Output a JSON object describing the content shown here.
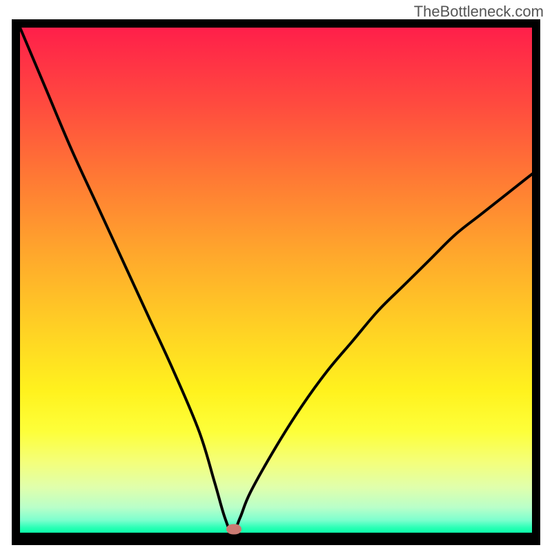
{
  "watermark": "TheBottleneck.com",
  "chart_data": {
    "type": "line",
    "title": "",
    "xlabel": "",
    "ylabel": "",
    "xlim": [
      0,
      100
    ],
    "ylim": [
      0,
      100
    ],
    "grid": false,
    "legend": false,
    "series": [
      {
        "name": "curve",
        "x": [
          0,
          5,
          10,
          15,
          20,
          25,
          30,
          35,
          38,
          40,
          41.5,
          43,
          45,
          50,
          55,
          60,
          65,
          70,
          75,
          80,
          85,
          90,
          95,
          100
        ],
        "y": [
          100,
          88,
          76,
          65,
          54,
          43,
          32,
          20,
          10,
          3,
          0,
          3,
          8,
          17,
          25,
          32,
          38,
          44,
          49,
          54,
          59,
          63,
          67,
          71
        ]
      }
    ],
    "marker": {
      "x": 41.8,
      "y": 0.7,
      "color": "#cb7a72"
    },
    "gradient_stops": [
      {
        "pct": 0,
        "color": "#ff1f4a"
      },
      {
        "pct": 15,
        "color": "#ff4a3f"
      },
      {
        "pct": 30,
        "color": "#ff7a34"
      },
      {
        "pct": 45,
        "color": "#ffa82c"
      },
      {
        "pct": 60,
        "color": "#ffd224"
      },
      {
        "pct": 72,
        "color": "#fff21e"
      },
      {
        "pct": 80,
        "color": "#fdff3a"
      },
      {
        "pct": 86,
        "color": "#f4ff7a"
      },
      {
        "pct": 91,
        "color": "#e0ffac"
      },
      {
        "pct": 95,
        "color": "#b9ffc9"
      },
      {
        "pct": 97.5,
        "color": "#7dffce"
      },
      {
        "pct": 99,
        "color": "#2affb6"
      },
      {
        "pct": 100,
        "color": "#0cffa8"
      }
    ],
    "frame_color": "#000000"
  }
}
